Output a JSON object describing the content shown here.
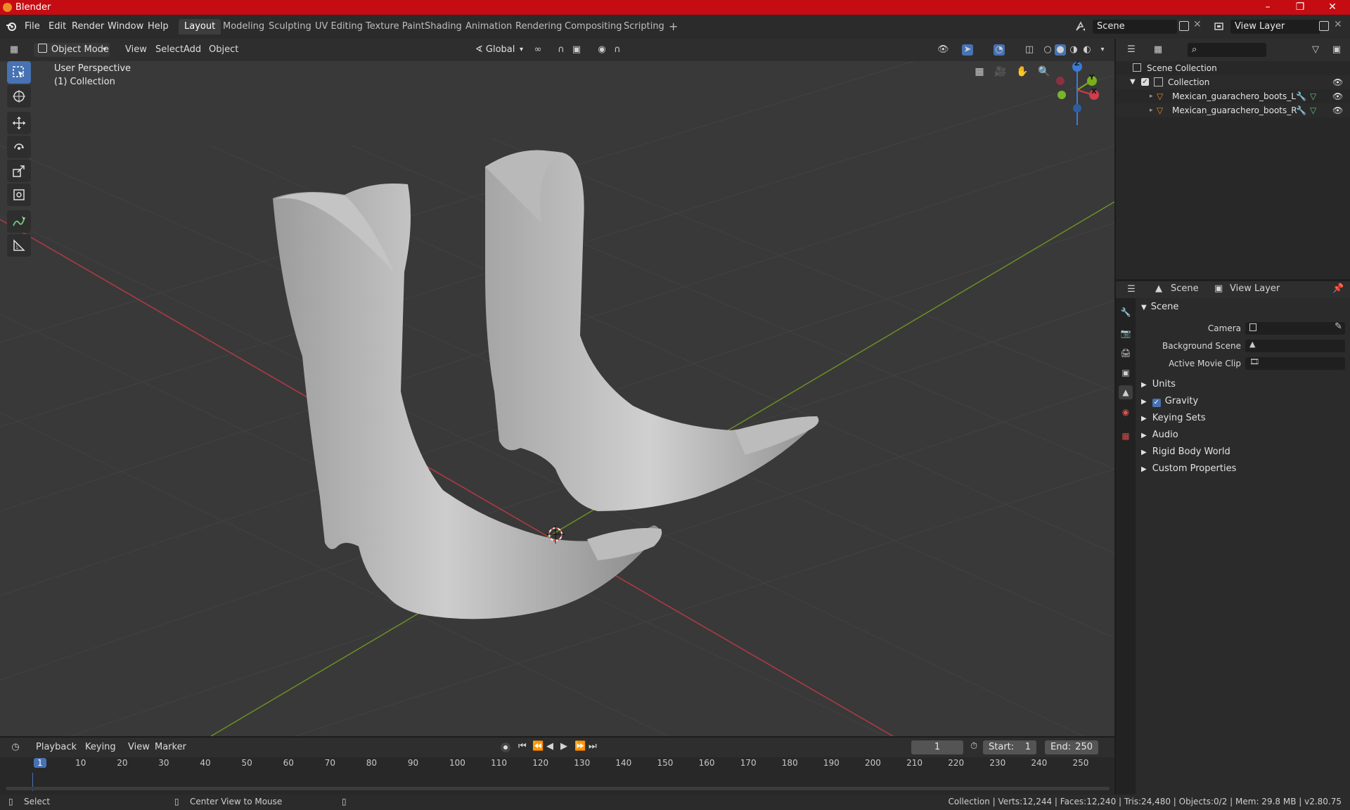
{
  "window": {
    "title": "Blender"
  },
  "menubar": {
    "items": [
      "File",
      "Edit",
      "Render",
      "Window",
      "Help"
    ],
    "workspaces": [
      "Layout",
      "Modeling",
      "Sculpting",
      "UV Editing",
      "Texture Paint",
      "Shading",
      "Animation",
      "Rendering",
      "Compositing",
      "Scripting"
    ],
    "active_workspace": "Layout",
    "add_tab": "+",
    "scene_name": "Scene",
    "view_layer_name": "View Layer"
  },
  "viewport_header": {
    "mode": "Object Mode",
    "menus": [
      "View",
      "Select",
      "Add",
      "Object"
    ],
    "orientation": "Global"
  },
  "viewport": {
    "perspective_label": "User Perspective",
    "collection_label": "(1) Collection",
    "gizmo_axes": [
      "X",
      "Y",
      "Z"
    ]
  },
  "outliner": {
    "rows": [
      {
        "label": "Scene Collection"
      },
      {
        "label": "Collection"
      },
      {
        "label": "Mexican_guarachero_boots_L"
      },
      {
        "label": "Mexican_guarachero_boots_R"
      }
    ]
  },
  "properties": {
    "header_scene": "Scene",
    "header_view_layer": "View Layer",
    "scene_panel": "Scene",
    "fields": [
      {
        "label": "Camera"
      },
      {
        "label": "Background Scene"
      },
      {
        "label": "Active Movie Clip"
      }
    ],
    "panels": [
      "Units",
      "Gravity",
      "Keying Sets",
      "Audio",
      "Rigid Body World",
      "Custom Properties"
    ],
    "gravity_checked": true
  },
  "timeline": {
    "menus": [
      "Playback",
      "Keying",
      "View",
      "Marker"
    ],
    "current_frame": "1",
    "start_label": "Start:",
    "start_value": "1",
    "end_label": "End:",
    "end_value": "250",
    "ticks": [
      "1",
      "10",
      "20",
      "30",
      "40",
      "50",
      "60",
      "70",
      "80",
      "90",
      "100",
      "110",
      "120",
      "130",
      "140",
      "150",
      "160",
      "170",
      "180",
      "190",
      "200",
      "210",
      "220",
      "230",
      "240",
      "250"
    ]
  },
  "statusbar": {
    "left_action": "Select",
    "middle_action": "Center View to Mouse",
    "stats": "Collection | Verts:12,244 | Faces:12,240 | Tris:24,480 | Objects:0/2 | Mem: 29.8 MB | v2.80.75"
  },
  "colors": {
    "title_bar": "#c40c12",
    "accent": "#4772b3",
    "x_axis": "#d23c4c",
    "y_axis": "#78b01a",
    "z_axis": "#3a7bd6"
  }
}
